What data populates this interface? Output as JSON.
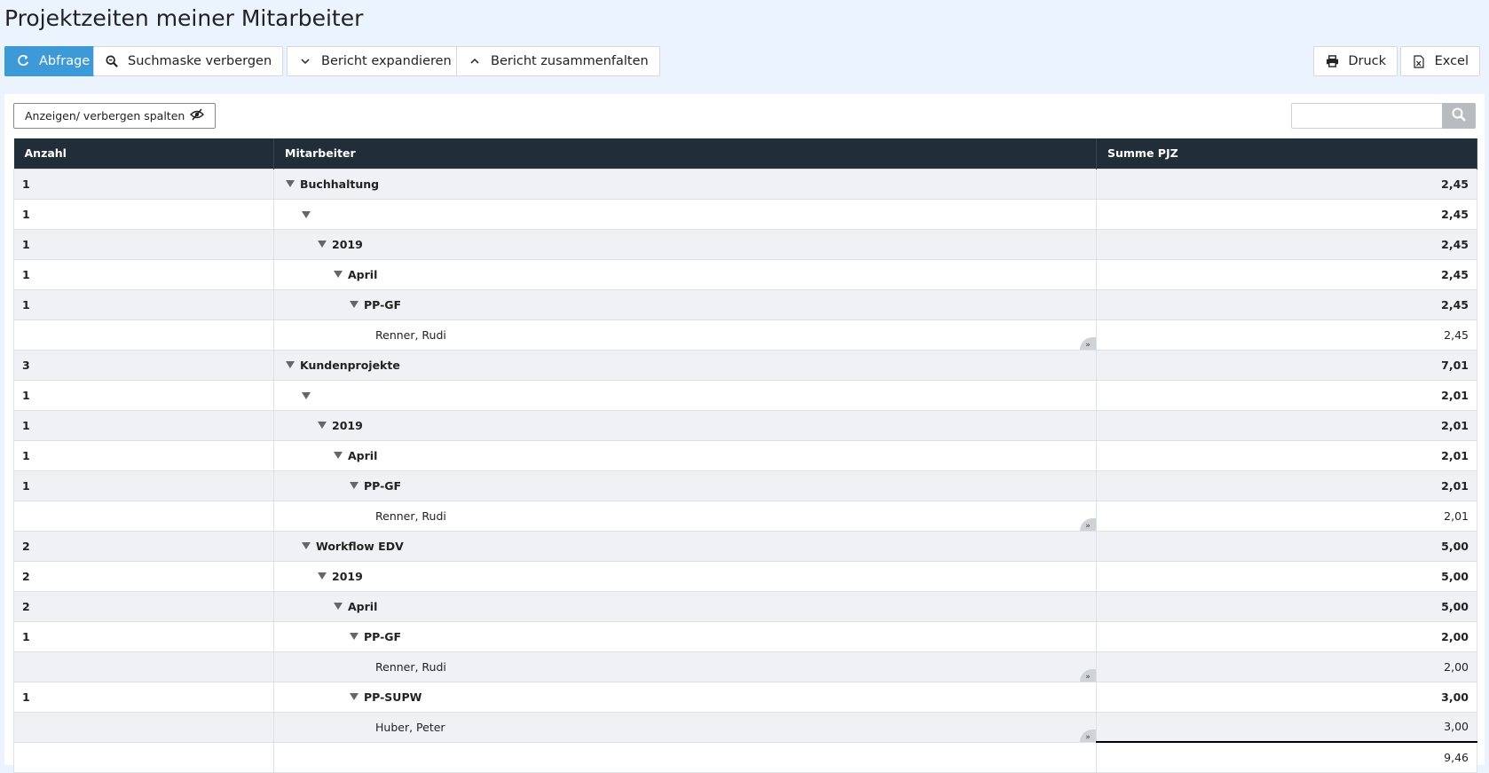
{
  "page": {
    "title": "Projektzeiten meiner Mitarbeiter"
  },
  "toolbar": {
    "query": "Abfrage",
    "hide_search": "Suchmaske verbergen",
    "expand": "Bericht expandieren",
    "collapse": "Bericht zusammenfalten",
    "print": "Druck",
    "excel": "Excel"
  },
  "colvis": {
    "label": "Anzeigen/ verbergen spalten"
  },
  "search": {
    "placeholder": ""
  },
  "colors": {
    "primary": "#3e9ad6",
    "header_bg": "#222d3a",
    "row_alt": "#f0f1f4"
  },
  "table": {
    "headers": [
      "Anzahl",
      "Mitarbeiter",
      "Summe PJZ"
    ],
    "rows": [
      {
        "count": "1",
        "label": "Buchhaltung",
        "level": 0,
        "sum": "2,45",
        "group": true
      },
      {
        "count": "1",
        "label": "",
        "level": 1,
        "sum": "2,45",
        "group": true
      },
      {
        "count": "1",
        "label": "2019",
        "level": 2,
        "sum": "2,45",
        "group": true
      },
      {
        "count": "1",
        "label": "April",
        "level": 3,
        "sum": "2,45",
        "group": true
      },
      {
        "count": "1",
        "label": "PP-GF",
        "level": 4,
        "sum": "2,45",
        "group": true
      },
      {
        "count": "",
        "label": "Renner, Rudi",
        "level": 5,
        "sum": "2,45",
        "group": false
      },
      {
        "count": "3",
        "label": "Kundenprojekte",
        "level": 0,
        "sum": "7,01",
        "group": true
      },
      {
        "count": "1",
        "label": "",
        "level": 1,
        "sum": "2,01",
        "group": true
      },
      {
        "count": "1",
        "label": "2019",
        "level": 2,
        "sum": "2,01",
        "group": true
      },
      {
        "count": "1",
        "label": "April",
        "level": 3,
        "sum": "2,01",
        "group": true
      },
      {
        "count": "1",
        "label": "PP-GF",
        "level": 4,
        "sum": "2,01",
        "group": true
      },
      {
        "count": "",
        "label": "Renner, Rudi",
        "level": 5,
        "sum": "2,01",
        "group": false
      },
      {
        "count": "2",
        "label": "Workflow EDV",
        "level": 1,
        "sum": "5,00",
        "group": true
      },
      {
        "count": "2",
        "label": "2019",
        "level": 2,
        "sum": "5,00",
        "group": true
      },
      {
        "count": "2",
        "label": "April",
        "level": 3,
        "sum": "5,00",
        "group": true
      },
      {
        "count": "1",
        "label": "PP-GF",
        "level": 4,
        "sum": "2,00",
        "group": true
      },
      {
        "count": "",
        "label": "Renner, Rudi",
        "level": 5,
        "sum": "2,00",
        "group": false
      },
      {
        "count": "1",
        "label": "PP-SUPW",
        "level": 4,
        "sum": "3,00",
        "group": true
      },
      {
        "count": "",
        "label": "Huber, Peter",
        "level": 5,
        "sum": "3,00",
        "group": false
      }
    ],
    "total": "9,46"
  }
}
